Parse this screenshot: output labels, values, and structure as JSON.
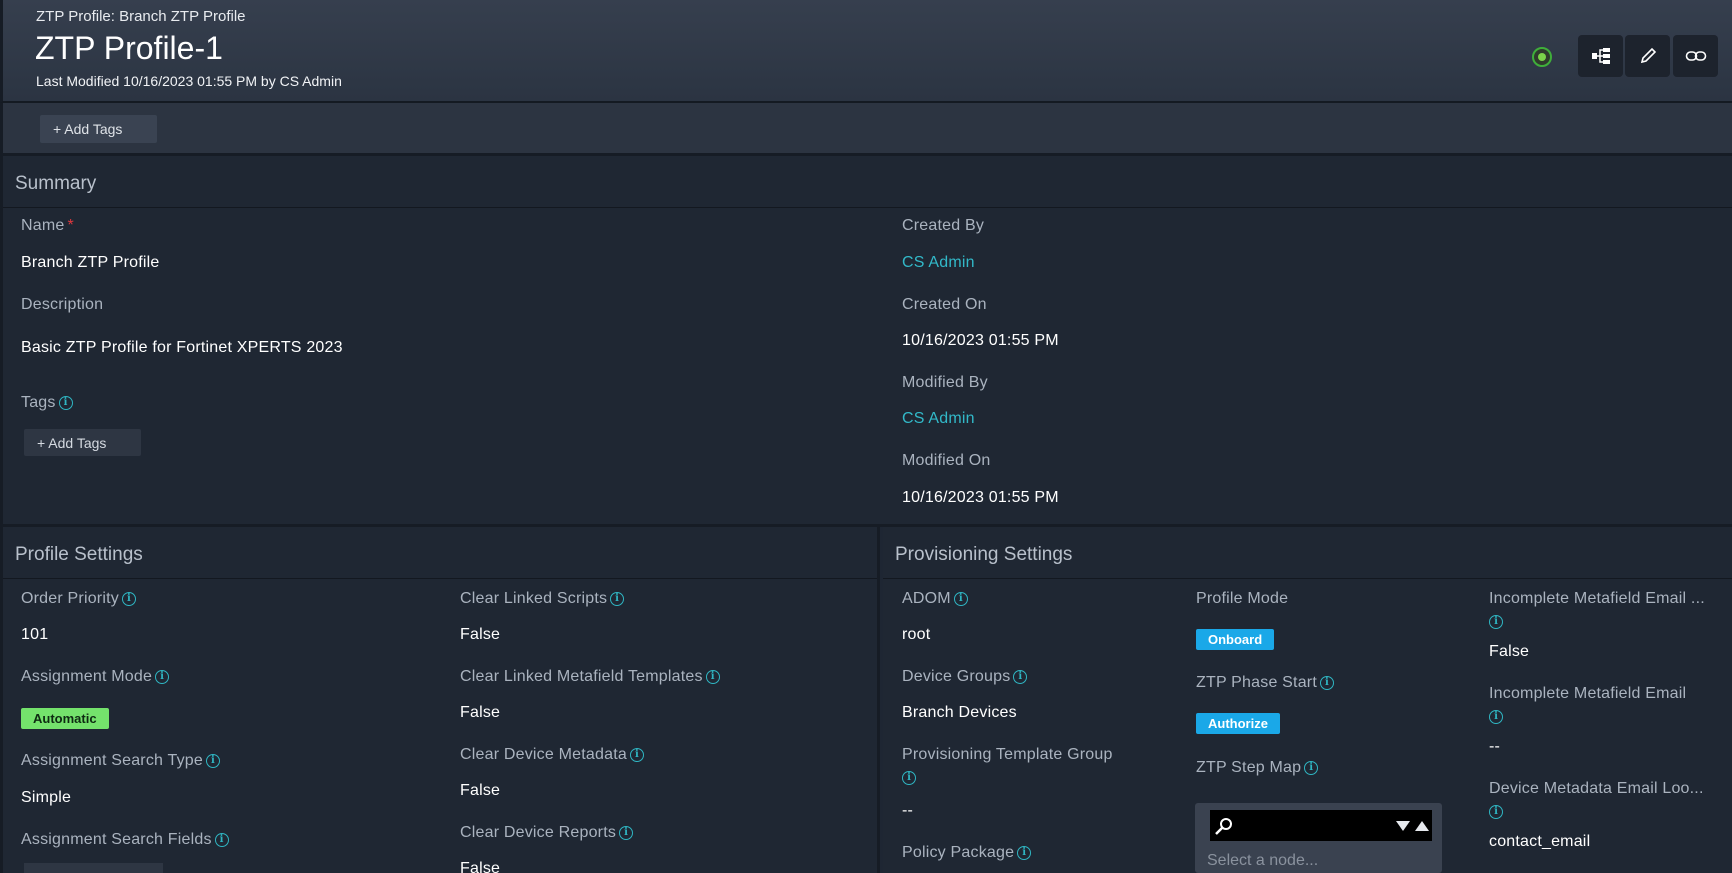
{
  "header": {
    "breadcrumb": "ZTP Profile: Branch ZTP Profile",
    "title": "ZTP Profile-1",
    "last_modified": "Last Modified 10/16/2023 01:55 PM by CS Admin",
    "status_color": "#3fae3a",
    "actions": [
      "hierarchy-icon",
      "pencil-icon",
      "link-icon"
    ]
  },
  "tagbar": {
    "add_tags": "+ Add Tags"
  },
  "summary": {
    "title": "Summary",
    "name_label": "Name",
    "required_mark": "*",
    "name_value": "Branch ZTP Profile",
    "description_label": "Description",
    "description_value": "Basic ZTP Profile for Fortinet XPERTS 2023",
    "tags_label": "Tags",
    "add_tags": "+ Add Tags",
    "created_by_label": "Created By",
    "created_by_value": "CS Admin",
    "created_on_label": "Created On",
    "created_on_value": "10/16/2023 01:55 PM",
    "modified_by_label": "Modified By",
    "modified_by_value": "CS Admin",
    "modified_on_label": "Modified On",
    "modified_on_value": "10/16/2023 01:55 PM"
  },
  "profile_settings": {
    "title": "Profile Settings",
    "order_priority_label": "Order Priority",
    "order_priority_value": "101",
    "assignment_mode_label": "Assignment Mode",
    "assignment_mode_value": "Automatic",
    "assignment_search_type_label": "Assignment Search Type",
    "assignment_search_type_value": "Simple",
    "assignment_search_fields_label": "Assignment Search Fields",
    "clear_linked_scripts_label": "Clear Linked Scripts",
    "clear_linked_scripts_value": "False",
    "clear_linked_metafield_templates_label": "Clear Linked Metafield Templates",
    "clear_linked_metafield_templates_value": "False",
    "clear_device_metadata_label": "Clear Device Metadata",
    "clear_device_metadata_value": "False",
    "clear_device_reports_label": "Clear Device Reports",
    "clear_device_reports_value": "False"
  },
  "provisioning_settings": {
    "title": "Provisioning Settings",
    "adom_label": "ADOM",
    "adom_value": "root",
    "device_groups_label": "Device Groups",
    "device_groups_value": "Branch Devices",
    "provisioning_template_group_label": "Provisioning Template Group",
    "provisioning_template_group_value": "--",
    "policy_package_label": "Policy Package",
    "profile_mode_label": "Profile Mode",
    "profile_mode_value": "Onboard",
    "ztp_phase_start_label": "ZTP Phase Start",
    "ztp_phase_start_value": "Authorize",
    "ztp_step_map_label": "ZTP Step Map",
    "ztp_step_map_placeholder": "Select a node...",
    "incomplete_metafield_email_truncated_label": "Incomplete Metafield Email ...",
    "incomplete_metafield_email_truncated_value": "False",
    "incomplete_metafield_email_label": "Incomplete Metafield Email",
    "incomplete_metafield_email_value": "--",
    "device_metadata_email_label": "Device Metadata Email Loo...",
    "device_metadata_email_value": "contact_email"
  }
}
